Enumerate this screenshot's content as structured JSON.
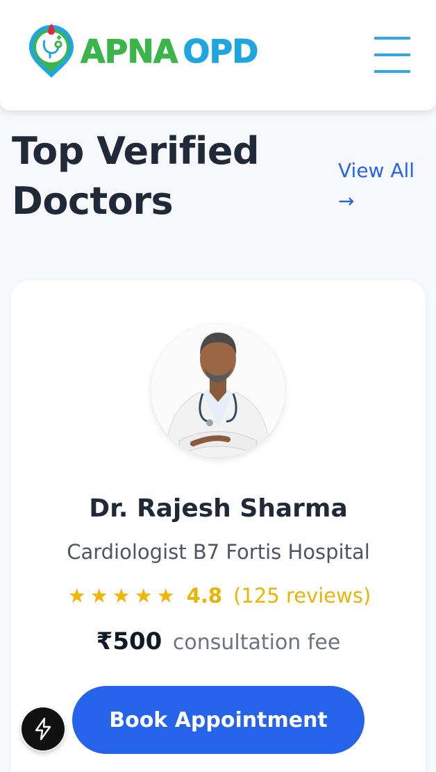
{
  "header": {
    "logo_part1": "APNA",
    "logo_part2": "OPD",
    "menu_icon": "hamburger-menu-icon"
  },
  "section": {
    "title": "Top Verified Doctors",
    "view_all": "View All",
    "view_all_arrow": "→"
  },
  "doctor": {
    "avatar": "doctor-photo",
    "name": "Dr. Rajesh Sharma",
    "specialty": "Cardiologist B7 Fortis Hospital",
    "rating": "4.8",
    "rating_stars": 5,
    "reviews": "(125 reviews)",
    "fee_amount": "₹500",
    "fee_label": "consultation fee",
    "book_label": "Book Appointment"
  },
  "fab": {
    "icon": "lightning-bolt-icon"
  },
  "colors": {
    "accent": "#2563eb",
    "logo_green": "#3bb54a",
    "logo_blue": "#1fa6e0",
    "star": "#f5b301",
    "title": "#1f2937"
  }
}
